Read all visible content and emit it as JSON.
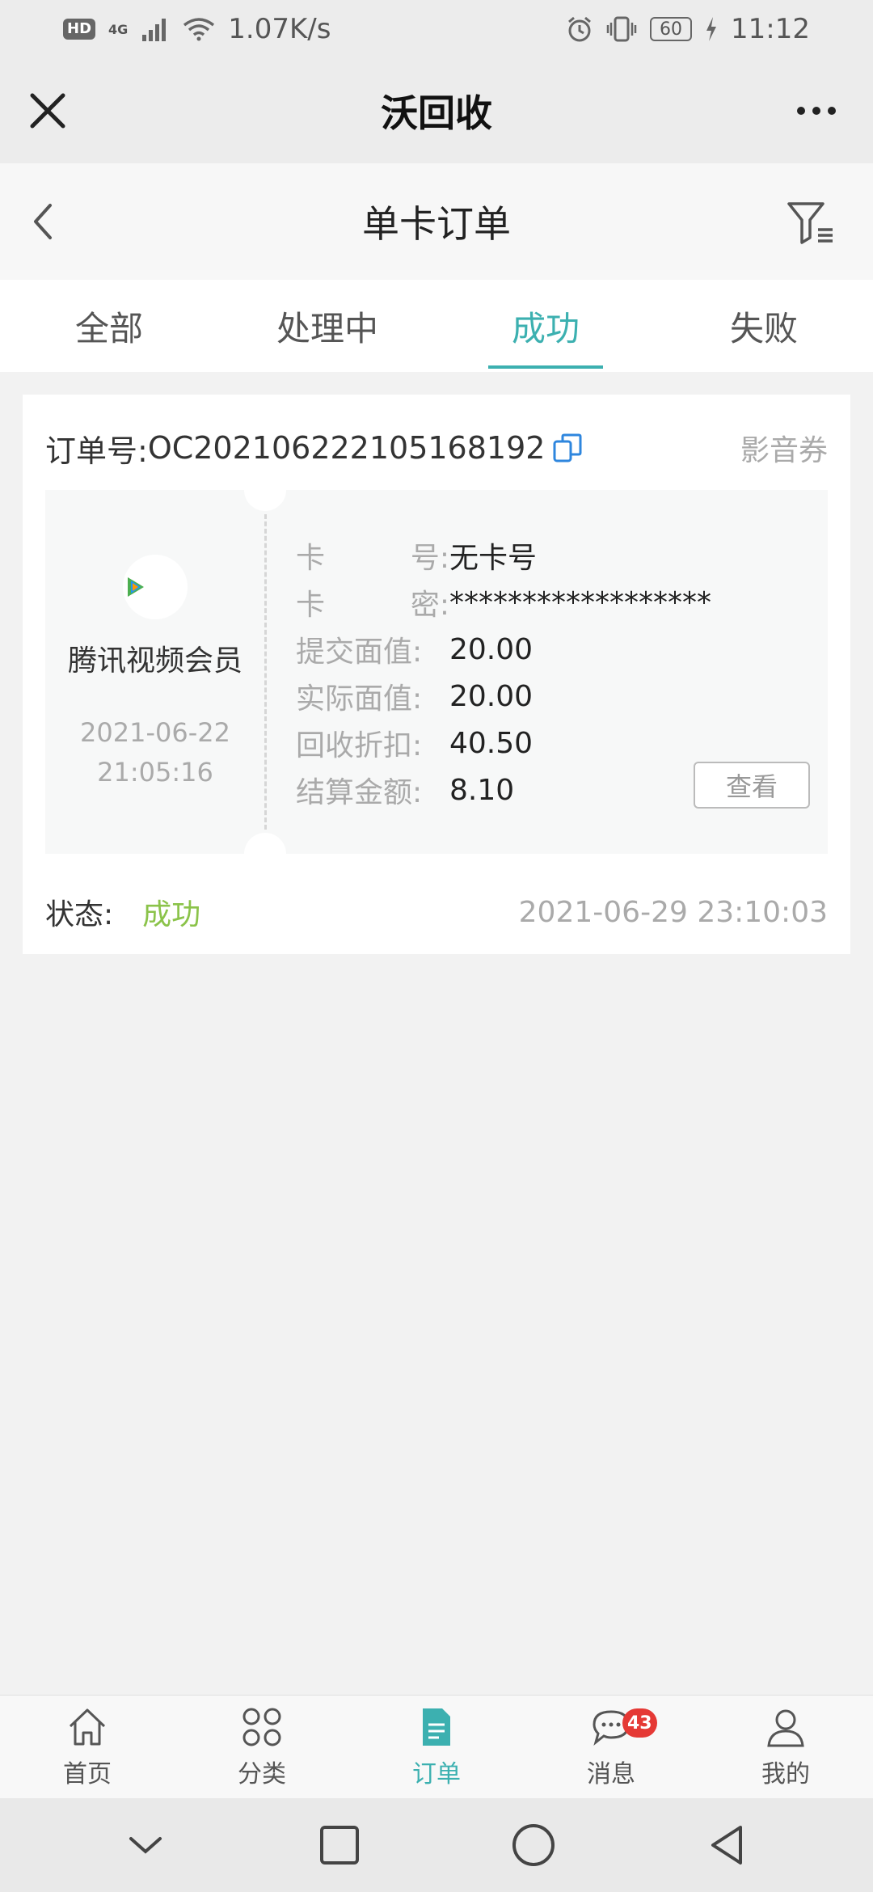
{
  "status_bar": {
    "hd": "HD",
    "network": "4G",
    "speed": "1.07K/s",
    "battery": "60",
    "time": "11:12"
  },
  "app": {
    "title": "沃回收"
  },
  "page": {
    "title": "单卡订单"
  },
  "tabs": [
    {
      "label": "全部",
      "active": false
    },
    {
      "label": "处理中",
      "active": false
    },
    {
      "label": "成功",
      "active": true
    },
    {
      "label": "失败",
      "active": false
    }
  ],
  "order": {
    "order_label": "订单号:",
    "order_number": "OC202106222105168192",
    "type": "影音券",
    "product_name": "腾讯视频会员",
    "logo_text": "腾讯视频",
    "date": "2021-06-22",
    "time": "21:05:16",
    "fields": [
      {
        "label_a": "卡",
        "label_b": "号:",
        "value": "无卡号"
      },
      {
        "label_a": "卡",
        "label_b": "密:",
        "value": "******************"
      },
      {
        "label_a": "提交面值:",
        "label_b": "",
        "value": "20.00"
      },
      {
        "label_a": "实际面值:",
        "label_b": "",
        "value": "20.00"
      },
      {
        "label_a": "回收折扣:",
        "label_b": "",
        "value": "40.50"
      },
      {
        "label_a": "结算金额:",
        "label_b": "",
        "value": "8.10"
      }
    ],
    "view_label": "查看",
    "status_label": "状态:",
    "status_value": "成功",
    "status_time": "2021-06-29 23:10:03"
  },
  "bottom_nav": [
    {
      "label": "首页",
      "icon": "home-icon",
      "active": false,
      "badge": ""
    },
    {
      "label": "分类",
      "icon": "category-icon",
      "active": false,
      "badge": ""
    },
    {
      "label": "订单",
      "icon": "order-icon",
      "active": true,
      "badge": ""
    },
    {
      "label": "消息",
      "icon": "message-icon",
      "active": false,
      "badge": "43"
    },
    {
      "label": "我的",
      "icon": "user-icon",
      "active": false,
      "badge": ""
    }
  ],
  "colors": {
    "accent": "#3cb0b0",
    "success": "#8bc34a",
    "badge": "#e53935"
  }
}
